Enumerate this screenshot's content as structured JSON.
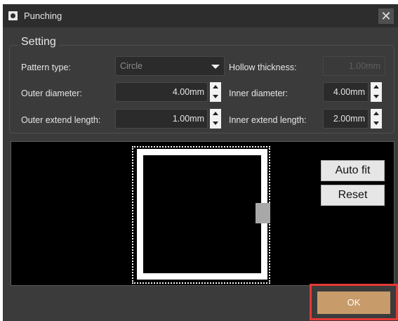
{
  "window": {
    "title": "Punching",
    "close_label": "✕"
  },
  "setting": {
    "legend": "Setting",
    "pattern_type_label": "Pattern type:",
    "pattern_type_value": "Circle",
    "hollow_thickness_label": "Hollow thickness:",
    "hollow_thickness_value": "1.00mm",
    "outer_diameter_label": "Outer diameter:",
    "outer_diameter_value": "4.00mm",
    "inner_diameter_label": "Inner diameter:",
    "inner_diameter_value": "4.00mm",
    "outer_extend_label": "Outer extend length:",
    "outer_extend_value": "1.00mm",
    "inner_extend_label": "Inner extend length:",
    "inner_extend_value": "2.00mm"
  },
  "preview": {
    "auto_fit_label": "Auto fit",
    "reset_label": "Reset"
  },
  "footer": {
    "ok_label": "OK"
  },
  "colors": {
    "ok_accent": "#c89b6a",
    "highlight": "#e53935",
    "panel_bg": "#3b3b3b"
  },
  "icons": {
    "app": "punching-icon",
    "close": "close-icon",
    "dropdown": "chevron-down-icon",
    "spin_up": "arrow-up-icon",
    "spin_down": "arrow-down-icon"
  }
}
